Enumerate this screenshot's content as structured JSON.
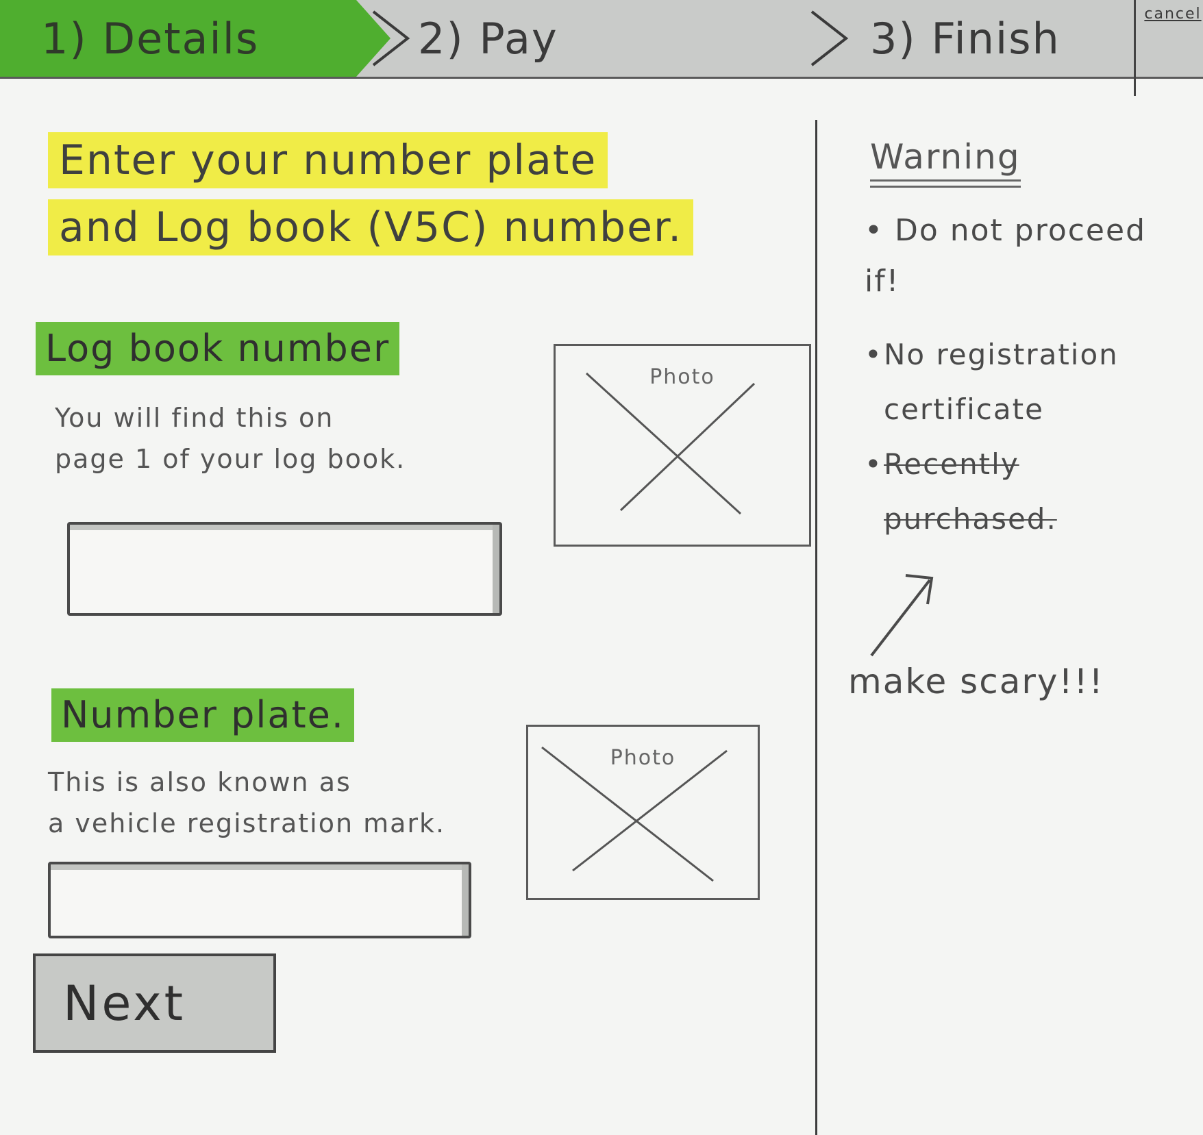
{
  "steps": {
    "details": "1) Details",
    "pay": "2) Pay",
    "finish": "3) Finish",
    "cancel": "cancel"
  },
  "heading": {
    "line1": "Enter your number plate",
    "line2": "and Log book (V5C) number."
  },
  "logbook": {
    "label": "Log book number",
    "help_line1": "You will find this on",
    "help_line2": "page 1 of your log book.",
    "value": "",
    "photo_label": "Photo"
  },
  "plate": {
    "label": "Number plate.",
    "help_line1": "This is also known as",
    "help_line2": "a vehicle registration mark.",
    "value": "",
    "photo_label": "Photo"
  },
  "next_label": "Next",
  "sidebar": {
    "warning_title": "Warning",
    "intro_line1": "• Do not proceed",
    "intro_line2": "if!",
    "bullets": [
      "No registration certificate",
      "Recently purchased."
    ],
    "note": "make scary!!!"
  },
  "colors": {
    "active_step": "#4fae2f",
    "section_highlight": "#6dbf3f",
    "heading_highlight": "#f0ec47"
  }
}
